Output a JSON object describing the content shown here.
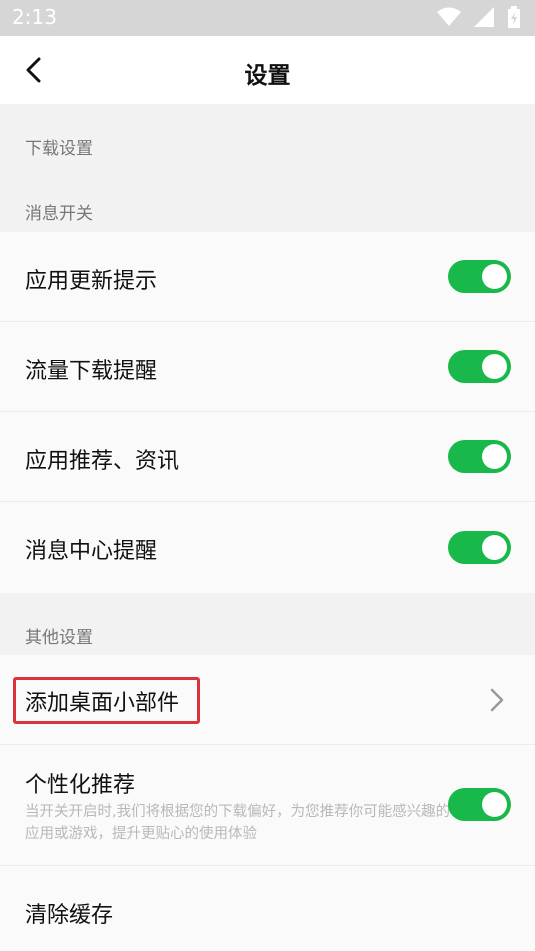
{
  "status_bar": {
    "time": "2:13",
    "icons": [
      "wifi-icon",
      "cellular-icon",
      "battery-charging-icon"
    ]
  },
  "header": {
    "title": "设置",
    "back_icon": "back-arrow-icon"
  },
  "sections": {
    "download": {
      "title": "下载设置"
    },
    "notifications": {
      "title": "消息开关",
      "items": [
        {
          "label": "应用更新提示",
          "enabled": true
        },
        {
          "label": "流量下载提醒",
          "enabled": true
        },
        {
          "label": "应用推荐、资讯",
          "enabled": true
        },
        {
          "label": "消息中心提醒",
          "enabled": true
        }
      ]
    },
    "other": {
      "title": "其他设置",
      "widget": {
        "label": "添加桌面小部件",
        "icon": "chevron-right-icon"
      },
      "personalized": {
        "label": "个性化推荐",
        "description": "当开关开启时,我们将根据您的下载偏好，为您推荐你可能感兴趣的应用或游戏，提升更贴心的使用体验",
        "enabled": true
      },
      "clear_cache": {
        "label": "清除缓存"
      }
    }
  },
  "colors": {
    "accent_green": "#19b84a",
    "highlight_red": "#d9343b",
    "status_bar_bg": "#d6d6d6"
  }
}
